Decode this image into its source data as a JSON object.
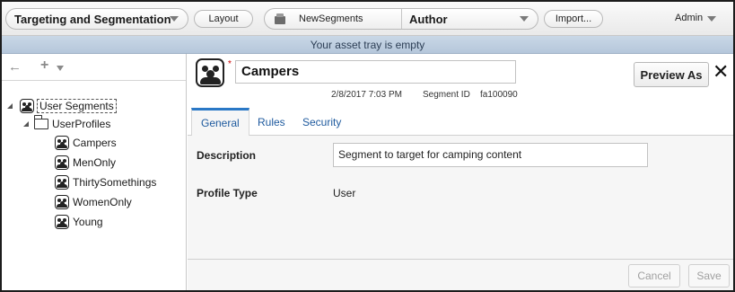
{
  "topbar": {
    "app_name": "Targeting and Segmentation",
    "layout_label": "Layout",
    "asset_group": "NewSegments",
    "role": "Author",
    "import_label": "Import...",
    "user": "Admin"
  },
  "tray": {
    "message": "Your asset tray is empty"
  },
  "tree": {
    "root": "User Segments",
    "folder": "UserProfiles",
    "items": [
      "Campers",
      "MenOnly",
      "ThirtySomethings",
      "WomenOnly",
      "Young"
    ]
  },
  "segment": {
    "name": "Campers",
    "date": "2/8/2017 7:03 PM",
    "id_label": "Segment ID",
    "id_value": "fa100090",
    "preview_label": "Preview As"
  },
  "tabs": [
    "General",
    "Rules",
    "Security"
  ],
  "active_tab": "General",
  "form": {
    "description_label": "Description",
    "description_value": "Segment to target for camping content",
    "profile_type_label": "Profile Type",
    "profile_type_value": "User"
  },
  "footer": {
    "cancel_label": "Cancel",
    "save_label": "Save"
  },
  "icons": {
    "back": "back-arrow-icon",
    "add": "plus-icon",
    "segment": "segment-group-icon",
    "folder": "folder-icon",
    "close": "close-icon",
    "asset_group": "box-icon"
  },
  "colors": {
    "tray_bg": "#bdcde0",
    "tab_accent": "#2a78c6",
    "link_blue": "#1e5a9e",
    "required": "#cc0000"
  }
}
